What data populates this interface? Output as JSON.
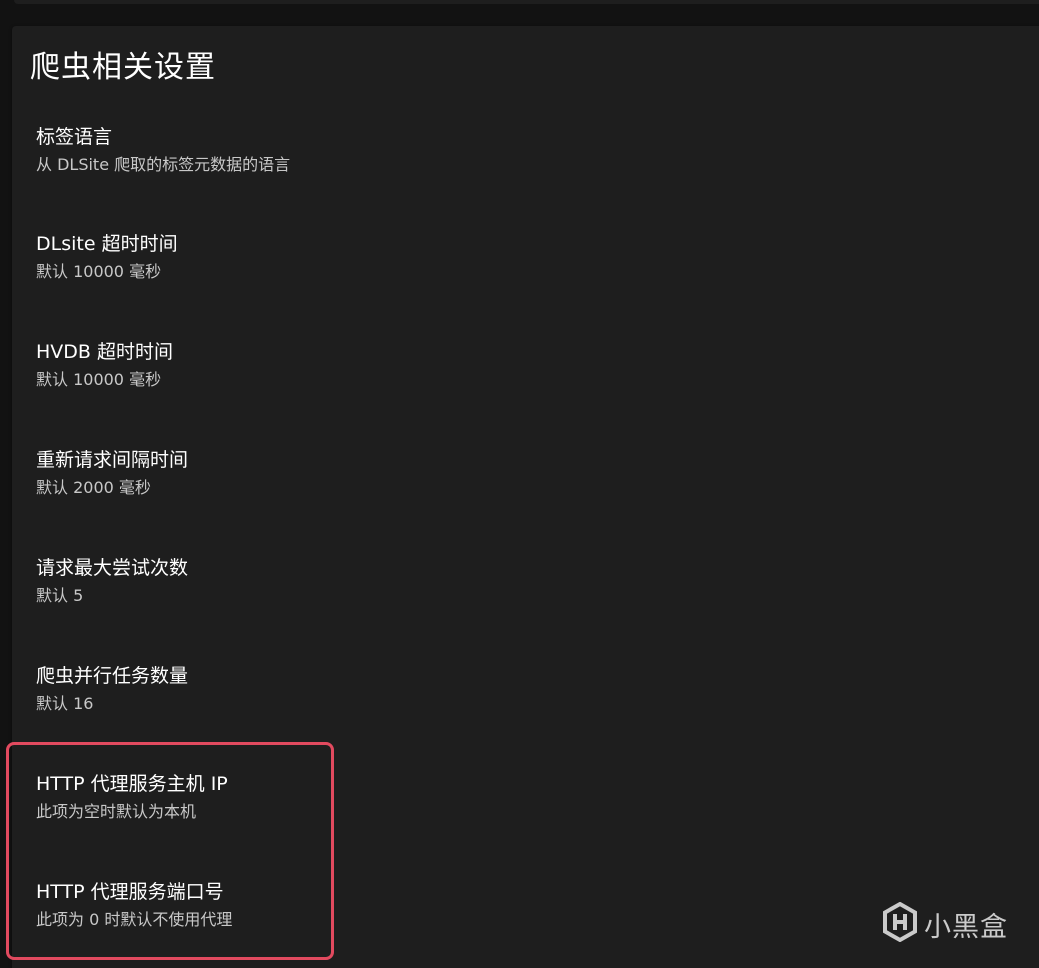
{
  "section": {
    "title": "爬虫相关设置"
  },
  "items": [
    {
      "title": "标签语言",
      "subtitle": "从 DLSite 爬取的标签元数据的语言"
    },
    {
      "title": "DLsite 超时时间",
      "subtitle": "默认 10000 毫秒"
    },
    {
      "title": "HVDB 超时时间",
      "subtitle": "默认 10000 毫秒"
    },
    {
      "title": "重新请求间隔时间",
      "subtitle": "默认 2000 毫秒"
    },
    {
      "title": "请求最大尝试次数",
      "subtitle": "默认 5"
    },
    {
      "title": "爬虫并行任务数量",
      "subtitle": "默认 16"
    },
    {
      "title": "HTTP 代理服务主机 IP",
      "subtitle": "此项为空时默认为本机"
    },
    {
      "title": "HTTP 代理服务端口号",
      "subtitle": "此项为 0 时默认不使用代理"
    }
  ],
  "watermark": {
    "text": "小黑盒",
    "icon": "xiaoheihe-logo-icon"
  },
  "colors": {
    "background": "#121212",
    "card": "#1e1e1e",
    "highlight": "#e24a5f"
  }
}
